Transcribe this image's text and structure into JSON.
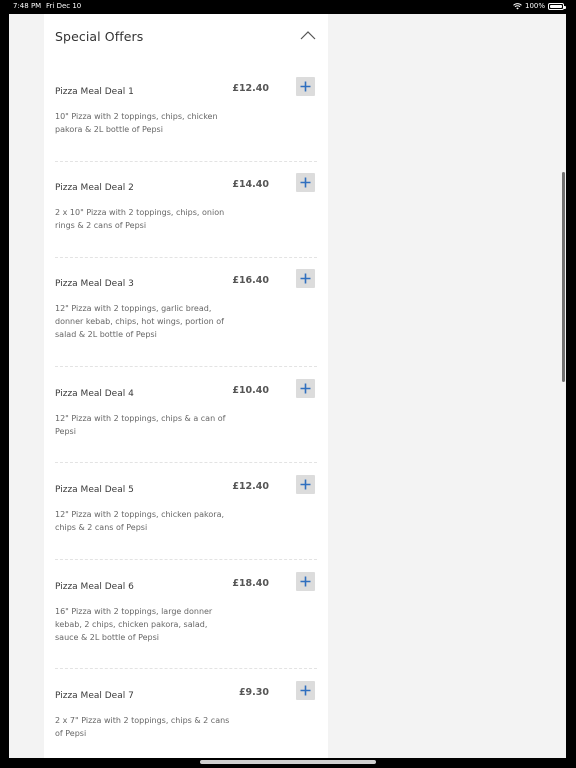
{
  "status_bar": {
    "time": "7:48 PM",
    "date": "Fri Dec 10",
    "battery": "100%"
  },
  "section": {
    "title": "Special Offers",
    "collapse_icon": "chevron-up-icon"
  },
  "items": [
    {
      "name": "Pizza Meal Deal 1",
      "price": "£12.40",
      "description": "10\" Pizza with 2 toppings, chips, chicken pakora & 2L bottle of Pepsi"
    },
    {
      "name": "Pizza Meal Deal 2",
      "price": "£14.40",
      "description": "2 x 10\" Pizza with 2 toppings, chips, onion rings & 2 cans of Pepsi"
    },
    {
      "name": "Pizza Meal Deal 3",
      "price": "£16.40",
      "description": "12\" Pizza with 2 toppings, garlic bread, donner kebab, chips, hot wings, portion of salad & 2L bottle of Pepsi"
    },
    {
      "name": "Pizza Meal Deal 4",
      "price": "£10.40",
      "description": "12\" Pizza with 2 toppings, chips & a can of Pepsi"
    },
    {
      "name": "Pizza Meal Deal 5",
      "price": "£12.40",
      "description": "12\" Pizza with 2 toppings, chicken pakora, chips & 2 cans of Pepsi"
    },
    {
      "name": "Pizza Meal Deal 6",
      "price": "£18.40",
      "description": "16\" Pizza with 2 toppings, large donner kebab, 2 chips, chicken pakora, salad, sauce & 2L bottle of Pepsi"
    },
    {
      "name": "Pizza Meal Deal 7",
      "price": "£9.30",
      "description": "2 x 7\" Pizza with 2 toppings, chips & 2 cans of Pepsi"
    }
  ],
  "colors": {
    "accent": "#2f6fbf",
    "add_button_bg": "#dcdcdc"
  }
}
